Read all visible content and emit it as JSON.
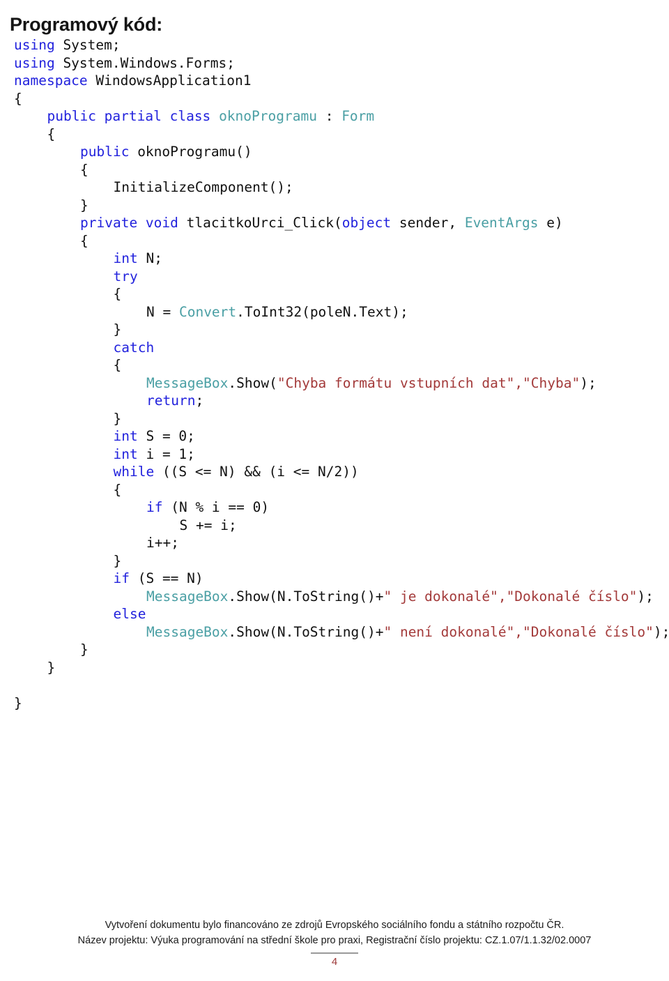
{
  "document": {
    "title": "Programový kód:",
    "page_number": "4"
  },
  "code": {
    "language": "csharp",
    "lines": [
      {
        "indent": 0,
        "tokens": [
          {
            "t": "kw",
            "v": "using"
          },
          {
            "t": "pl",
            "v": " System;"
          }
        ]
      },
      {
        "indent": 0,
        "tokens": [
          {
            "t": "kw",
            "v": "using"
          },
          {
            "t": "pl",
            "v": " System.Windows.Forms;"
          }
        ]
      },
      {
        "indent": 0,
        "tokens": [
          {
            "t": "kw",
            "v": "namespace"
          },
          {
            "t": "pl",
            "v": " WindowsApplication1"
          }
        ]
      },
      {
        "indent": 0,
        "tokens": [
          {
            "t": "pl",
            "v": "{"
          }
        ]
      },
      {
        "indent": 1,
        "tokens": [
          {
            "t": "kw",
            "v": "public partial class"
          },
          {
            "t": "pl",
            "v": " "
          },
          {
            "t": "type",
            "v": "oknoProgramu"
          },
          {
            "t": "pl",
            "v": " : "
          },
          {
            "t": "type",
            "v": "Form"
          }
        ]
      },
      {
        "indent": 1,
        "tokens": [
          {
            "t": "pl",
            "v": "{"
          }
        ]
      },
      {
        "indent": 2,
        "tokens": [
          {
            "t": "kw",
            "v": "public"
          },
          {
            "t": "pl",
            "v": " oknoProgramu()"
          }
        ]
      },
      {
        "indent": 2,
        "tokens": [
          {
            "t": "pl",
            "v": "{"
          }
        ]
      },
      {
        "indent": 3,
        "tokens": [
          {
            "t": "pl",
            "v": "InitializeComponent();"
          }
        ]
      },
      {
        "indent": 2,
        "tokens": [
          {
            "t": "pl",
            "v": "}"
          }
        ]
      },
      {
        "indent": 2,
        "tokens": [
          {
            "t": "kw",
            "v": "private void"
          },
          {
            "t": "pl",
            "v": " tlacitkoUrci_Click("
          },
          {
            "t": "kw",
            "v": "object"
          },
          {
            "t": "pl",
            "v": " sender, "
          },
          {
            "t": "type",
            "v": "EventArgs"
          },
          {
            "t": "pl",
            "v": " e)"
          }
        ]
      },
      {
        "indent": 2,
        "tokens": [
          {
            "t": "pl",
            "v": "{"
          }
        ]
      },
      {
        "indent": 3,
        "tokens": [
          {
            "t": "kw",
            "v": "int"
          },
          {
            "t": "pl",
            "v": " N;"
          }
        ]
      },
      {
        "indent": 3,
        "tokens": [
          {
            "t": "kw",
            "v": "try"
          }
        ]
      },
      {
        "indent": 3,
        "tokens": [
          {
            "t": "pl",
            "v": "{"
          }
        ]
      },
      {
        "indent": 4,
        "tokens": [
          {
            "t": "pl",
            "v": "N = "
          },
          {
            "t": "type",
            "v": "Convert"
          },
          {
            "t": "pl",
            "v": ".ToInt32(poleN.Text);"
          }
        ]
      },
      {
        "indent": 3,
        "tokens": [
          {
            "t": "pl",
            "v": "}"
          }
        ]
      },
      {
        "indent": 3,
        "tokens": [
          {
            "t": "kw",
            "v": "catch"
          }
        ]
      },
      {
        "indent": 3,
        "tokens": [
          {
            "t": "pl",
            "v": "{"
          }
        ]
      },
      {
        "indent": 4,
        "tokens": [
          {
            "t": "type",
            "v": "MessageBox"
          },
          {
            "t": "pl",
            "v": ".Show("
          },
          {
            "t": "str",
            "v": "\"Chyba formátu vstupních dat\",\"Chyba\""
          },
          {
            "t": "pl",
            "v": ");"
          }
        ]
      },
      {
        "indent": 4,
        "tokens": [
          {
            "t": "kw",
            "v": "return"
          },
          {
            "t": "pl",
            "v": ";"
          }
        ]
      },
      {
        "indent": 3,
        "tokens": [
          {
            "t": "pl",
            "v": "}"
          }
        ]
      },
      {
        "indent": 3,
        "tokens": [
          {
            "t": "kw",
            "v": "int"
          },
          {
            "t": "pl",
            "v": " S = 0;"
          }
        ]
      },
      {
        "indent": 3,
        "tokens": [
          {
            "t": "kw",
            "v": "int"
          },
          {
            "t": "pl",
            "v": " i = 1;"
          }
        ]
      },
      {
        "indent": 3,
        "tokens": [
          {
            "t": "kw",
            "v": "while"
          },
          {
            "t": "pl",
            "v": " ((S <= N) && (i <= N/2))"
          }
        ]
      },
      {
        "indent": 3,
        "tokens": [
          {
            "t": "pl",
            "v": "{"
          }
        ]
      },
      {
        "indent": 4,
        "tokens": [
          {
            "t": "kw",
            "v": "if"
          },
          {
            "t": "pl",
            "v": " (N % i == 0)"
          }
        ]
      },
      {
        "indent": 5,
        "tokens": [
          {
            "t": "pl",
            "v": "S += i;"
          }
        ]
      },
      {
        "indent": 4,
        "tokens": [
          {
            "t": "pl",
            "v": "i++;"
          }
        ]
      },
      {
        "indent": 3,
        "tokens": [
          {
            "t": "pl",
            "v": "}"
          }
        ]
      },
      {
        "indent": 3,
        "tokens": [
          {
            "t": "kw",
            "v": "if"
          },
          {
            "t": "pl",
            "v": " (S == N)"
          }
        ]
      },
      {
        "indent": 4,
        "tokens": [
          {
            "t": "type",
            "v": "MessageBox"
          },
          {
            "t": "pl",
            "v": ".Show(N.ToString()+"
          },
          {
            "t": "str",
            "v": "\" je dokonalé\",\"Dokonalé číslo\""
          },
          {
            "t": "pl",
            "v": ");"
          }
        ]
      },
      {
        "indent": 3,
        "tokens": [
          {
            "t": "kw",
            "v": "else"
          }
        ]
      },
      {
        "indent": 4,
        "tokens": [
          {
            "t": "type",
            "v": "MessageBox"
          },
          {
            "t": "pl",
            "v": ".Show(N.ToString()+"
          },
          {
            "t": "str",
            "v": "\" není dokonalé\",\"Dokonalé číslo\""
          },
          {
            "t": "pl",
            "v": ");"
          }
        ]
      },
      {
        "indent": 2,
        "tokens": [
          {
            "t": "pl",
            "v": "}"
          }
        ]
      },
      {
        "indent": 1,
        "tokens": [
          {
            "t": "pl",
            "v": "}"
          }
        ]
      },
      {
        "indent": 0,
        "tokens": [
          {
            "t": "pl",
            "v": ""
          }
        ]
      },
      {
        "indent": 0,
        "tokens": [
          {
            "t": "pl",
            "v": "}"
          }
        ]
      }
    ]
  },
  "footer": {
    "line1": "Vytvoření dokumentu bylo financováno ze zdrojů Evropského sociálního fondu a státního rozpočtu ČR.",
    "line2": "Název projektu: Výuka programování na střední škole pro praxi, Registrační číslo projektu: CZ.1.07/1.1.32/02.0007"
  },
  "colors": {
    "keyword": "#2222dd",
    "type": "#4a9fa4",
    "string": "#a33a3a",
    "plain": "#111111",
    "page_number": "#9e3a3a"
  }
}
